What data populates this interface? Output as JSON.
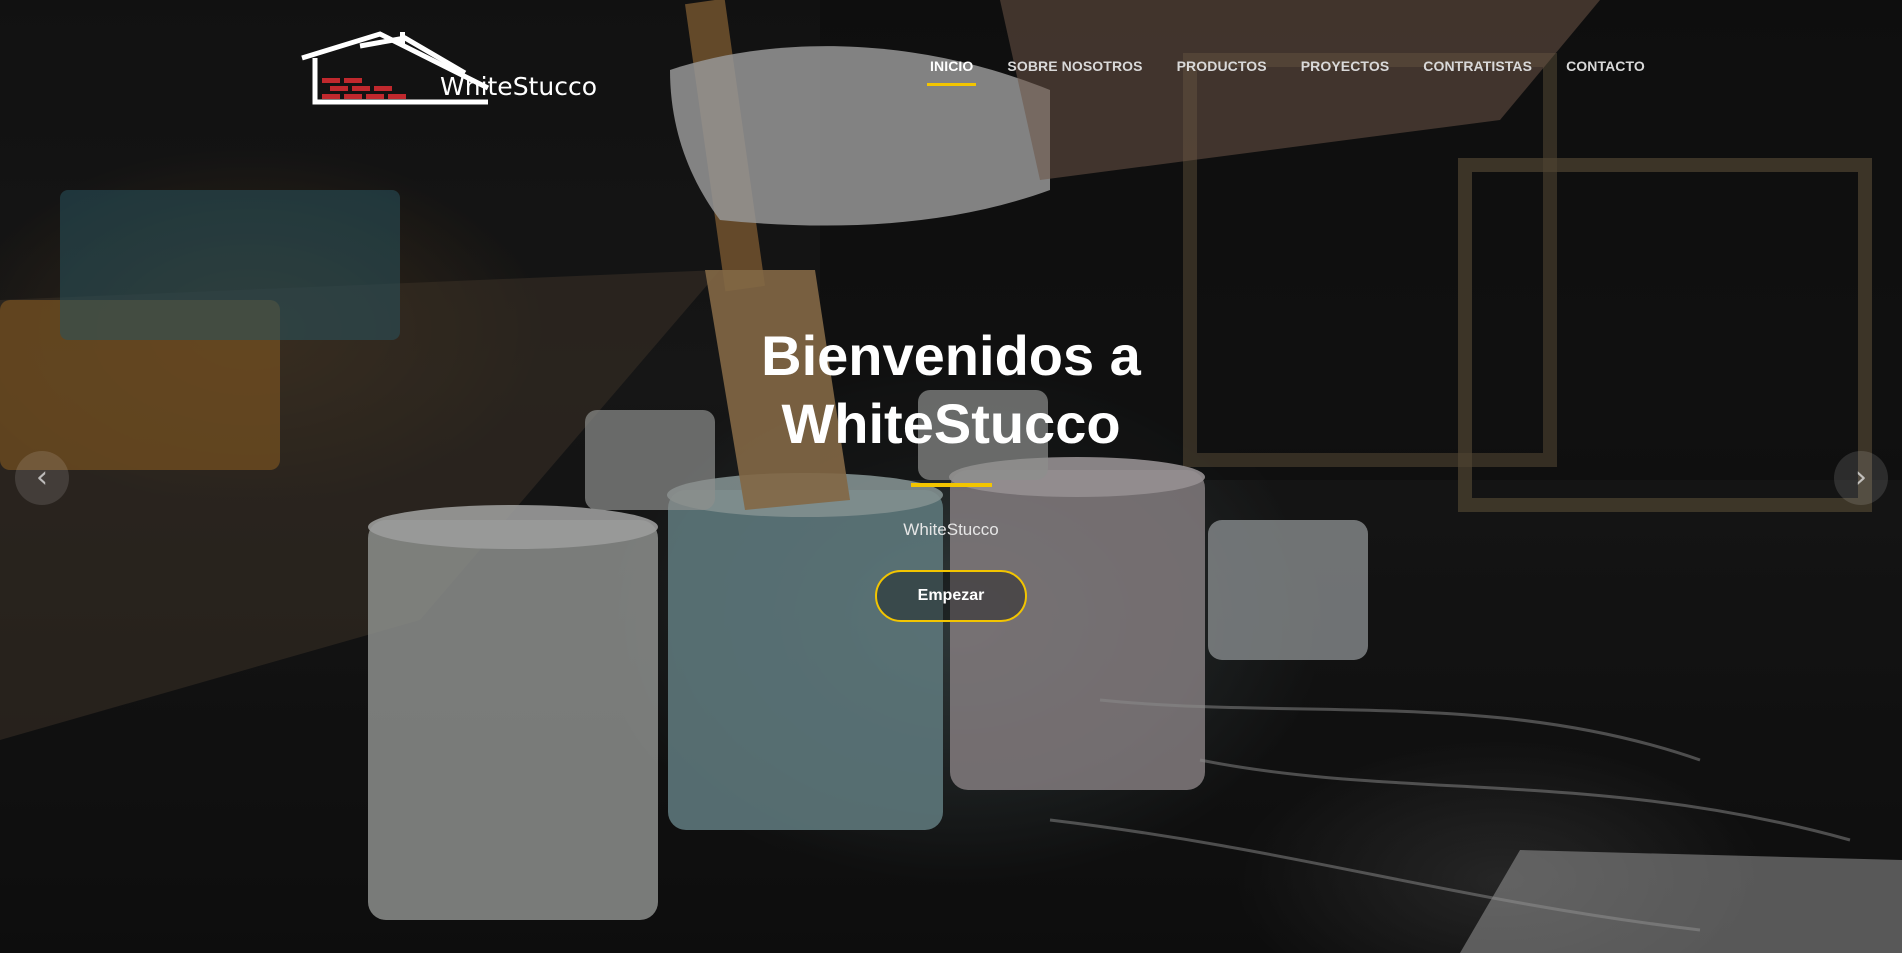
{
  "brand": {
    "name": "WhiteStucco"
  },
  "nav": {
    "items": [
      {
        "label": "INICIO",
        "active": true
      },
      {
        "label": "SOBRE NOSOTROS",
        "active": false
      },
      {
        "label": "PRODUCTOS",
        "active": false
      },
      {
        "label": "PROYECTOS",
        "active": false
      },
      {
        "label": "CONTRATISTAS",
        "active": false
      },
      {
        "label": "CONTACTO",
        "active": false
      }
    ]
  },
  "hero": {
    "title_line1": "Bienvenidos a",
    "title_line2": "WhiteStucco",
    "subtitle": "WhiteStucco",
    "cta_label": "Empezar"
  },
  "carousel": {
    "prev_icon": "chevron-left-icon",
    "next_icon": "chevron-right-icon",
    "prev_glyph": "‹",
    "next_glyph": "›"
  },
  "colors": {
    "accent": "#f3c500",
    "logo_brick": "#c0282d",
    "text": "#ffffff"
  }
}
